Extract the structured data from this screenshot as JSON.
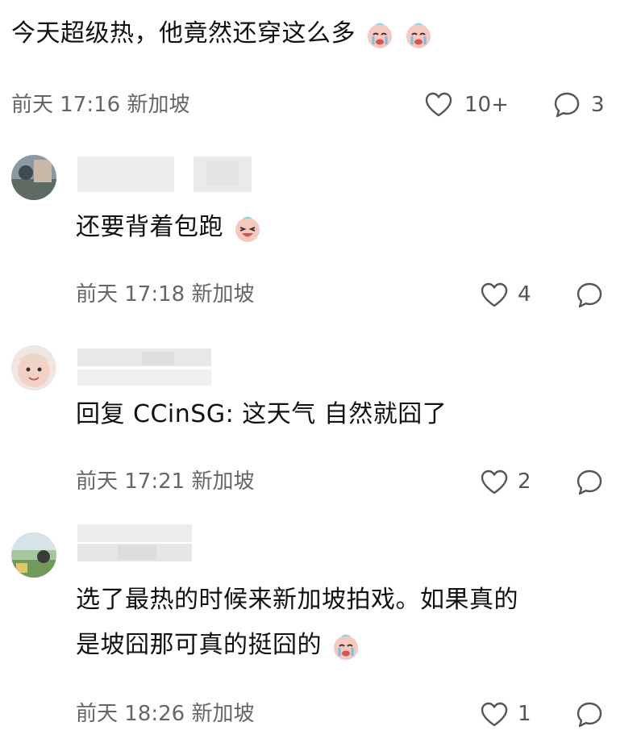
{
  "post": {
    "text": "今天超级热，他竟然还穿这么多",
    "meta_time": "前天 17:16",
    "meta_location": "新加坡",
    "likes": "10+",
    "replies": "3"
  },
  "comments": [
    {
      "text": "还要背着包跑",
      "meta_time": "前天 17:18",
      "meta_location": "新加坡",
      "likes": "4"
    },
    {
      "text": "回复 CCinSG: 这天气 自然就囧了",
      "meta_time": "前天 17:21",
      "meta_location": "新加坡",
      "likes": "2"
    },
    {
      "text_line1": "选了最热的时候来新加坡拍戏。如果真的",
      "text_line2": "是坡囧那可真的挺囧的",
      "meta_time": "前天 18:26",
      "meta_location": "新加坡",
      "likes": "1"
    }
  ],
  "icons": {
    "like": "heart-outline-icon",
    "reply": "speech-bubble-icon",
    "emoji_cry": "crying-face-emoji",
    "emoji_laugh": "laughing-face-emoji"
  },
  "colors": {
    "text": "#111111",
    "meta": "#666666",
    "icon": "#555555"
  }
}
